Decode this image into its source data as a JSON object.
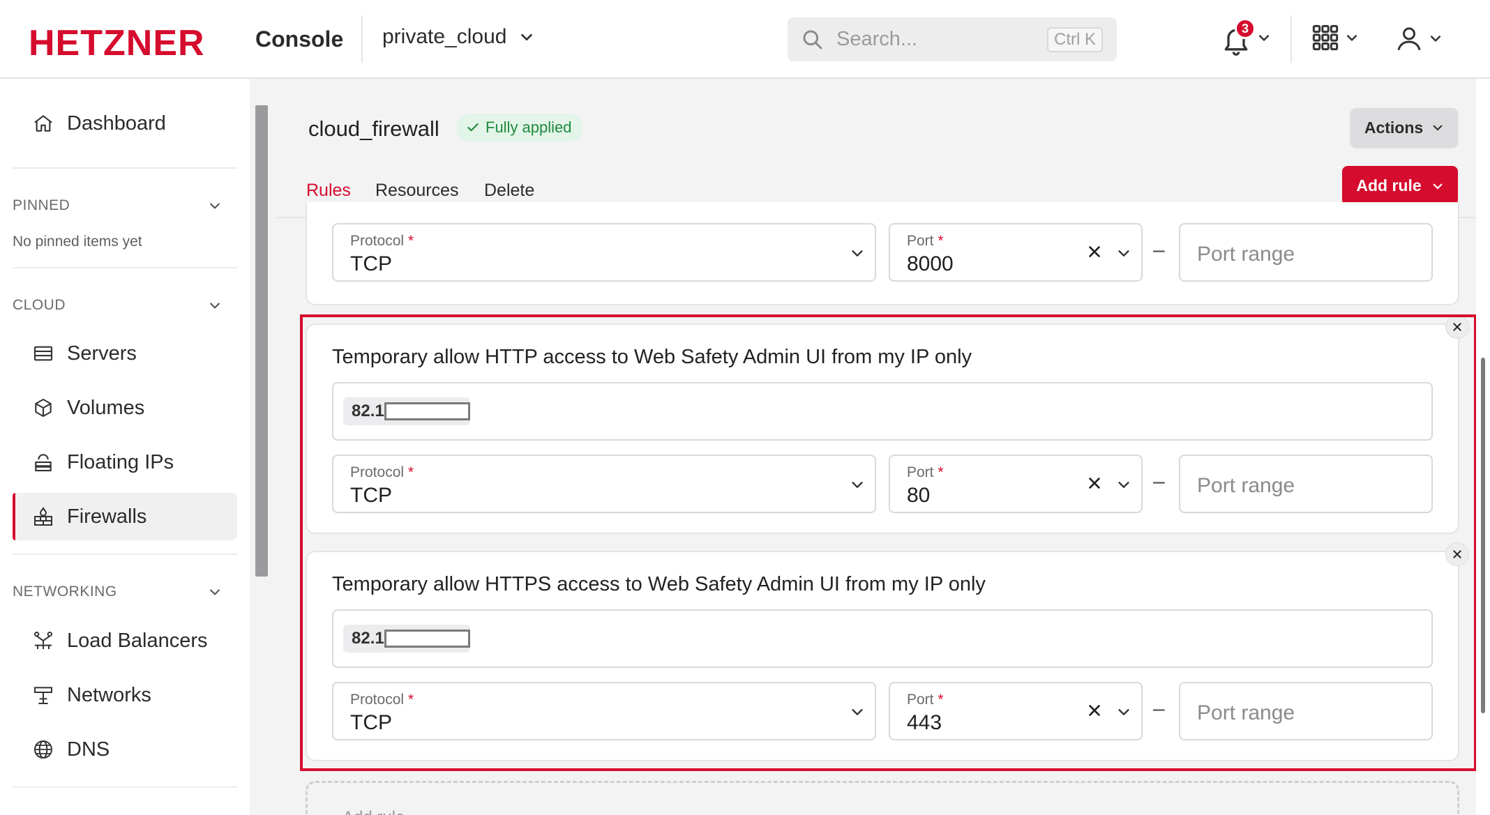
{
  "topbar": {
    "logo": "HETZNER",
    "console_label": "Console",
    "project": "private_cloud",
    "search_placeholder": "Search...",
    "search_shortcut": "Ctrl K",
    "notification_count": "3"
  },
  "sidebar": {
    "dashboard": "Dashboard",
    "pinned": {
      "title": "PINNED",
      "empty": "No pinned items yet"
    },
    "cloud": {
      "title": "CLOUD",
      "items": [
        {
          "label": "Servers",
          "icon": "server-icon"
        },
        {
          "label": "Volumes",
          "icon": "cube-icon"
        },
        {
          "label": "Floating IPs",
          "icon": "floating-ip-icon"
        },
        {
          "label": "Firewalls",
          "icon": "firewall-icon",
          "active": true
        }
      ]
    },
    "networking": {
      "title": "NETWORKING",
      "items": [
        {
          "label": "Load Balancers",
          "icon": "load-balancer-icon"
        },
        {
          "label": "Networks",
          "icon": "network-icon"
        },
        {
          "label": "DNS",
          "icon": "globe-icon"
        }
      ]
    }
  },
  "page": {
    "title": "cloud_firewall",
    "status": "Fully applied",
    "actions_label": "Actions",
    "add_rule_label": "Add rule",
    "tabs": [
      {
        "label": "Rules",
        "active": true
      },
      {
        "label": "Resources"
      },
      {
        "label": "Delete"
      }
    ]
  },
  "rules": [
    {
      "protocol_label": "Protocol",
      "protocol": "TCP",
      "port_label": "Port",
      "port": "8000",
      "port_range_placeholder": "Port range"
    },
    {
      "description": "Temporary allow HTTP access to Web Safety Admin UI from my IP only",
      "ip": "82.1",
      "protocol_label": "Protocol",
      "protocol": "TCP",
      "port_label": "Port",
      "port": "80",
      "port_range_placeholder": "Port range"
    },
    {
      "description": "Temporary allow HTTPS access to Web Safety Admin UI from my IP only",
      "ip": "82.1",
      "protocol_label": "Protocol",
      "protocol": "TCP",
      "port_label": "Port",
      "port": "443",
      "port_range_placeholder": "Port range"
    }
  ],
  "add_rule_placeholder": "Add rule",
  "colors": {
    "brand": "#d50c2d",
    "success": "#1e8a3e"
  }
}
